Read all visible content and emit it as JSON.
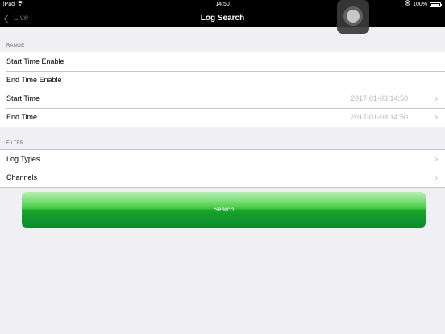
{
  "status_bar": {
    "device": "iPad",
    "wifi_icon": "wifi-icon",
    "time": "14:50",
    "battery_percent": "100%",
    "battery_level": 1.0
  },
  "nav": {
    "back_label": "Live",
    "title": "Log Search"
  },
  "range": {
    "header": "RANGE",
    "rows": [
      {
        "label": "Start Time Enable"
      },
      {
        "label": "End Time Enable"
      },
      {
        "label": "Start Time",
        "value": "2017-01-03 14:50"
      },
      {
        "label": "End Time",
        "value": "2017-01-03 14:50"
      }
    ]
  },
  "filter": {
    "header": "FILTER",
    "rows": [
      {
        "label": "Log Types"
      },
      {
        "label": "Channels"
      }
    ]
  },
  "search_button": {
    "label": "Search",
    "color": "#1aa52a"
  }
}
